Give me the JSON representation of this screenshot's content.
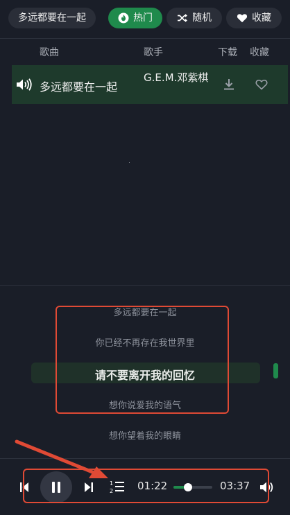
{
  "header": {
    "current_song": "多远都要在一起",
    "chips": [
      {
        "label": "热门",
        "icon": "flame-icon",
        "active": true
      },
      {
        "label": "随机",
        "icon": "shuffle-icon",
        "active": false
      },
      {
        "label": "收藏",
        "icon": "heart-icon",
        "active": false
      }
    ]
  },
  "table": {
    "columns": [
      "歌曲",
      "歌手",
      "下载",
      "收藏"
    ],
    "rows": [
      {
        "title": "多远都要在一起",
        "artist": "G.E.M.邓紫棋",
        "playing": true
      }
    ]
  },
  "lyrics": {
    "lines": [
      "多远都要在一起",
      "你已经不再存在我世界里",
      "请不要离开我的回忆",
      "想你说爱我的语气",
      "想你望着我的眼睛"
    ],
    "current_index": 2
  },
  "player": {
    "elapsed": "01:22",
    "duration": "03:37",
    "progress": 0.378
  },
  "colors": {
    "accent": "#1f8a4c",
    "annotation": "#e04a35",
    "background": "#1a1e28"
  }
}
